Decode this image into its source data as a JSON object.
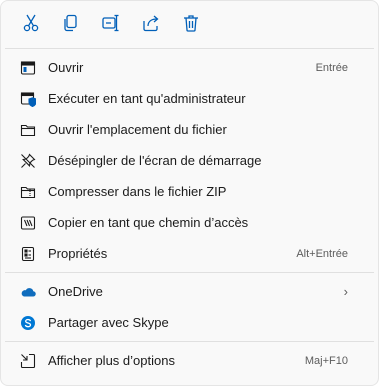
{
  "toolbar": {
    "buttons": [
      {
        "icon": "scissors-icon",
        "tooltip": "Couper"
      },
      {
        "icon": "copy-icon",
        "tooltip": "Copier"
      },
      {
        "icon": "rename-icon",
        "tooltip": "Renommer"
      },
      {
        "icon": "share-icon",
        "tooltip": "Partager"
      },
      {
        "icon": "trash-icon",
        "tooltip": "Supprimer"
      }
    ]
  },
  "group1": [
    {
      "label": "Ouvrir",
      "shortcut": "Entrée",
      "icon": "window-icon"
    },
    {
      "label": "Exécuter en tant qu'administrateur",
      "shortcut": "",
      "icon": "shield-window-icon"
    },
    {
      "label": "Ouvrir l'emplacement du fichier",
      "shortcut": "",
      "icon": "folder-icon"
    },
    {
      "label": "Désépingler de l'écran de démarrage",
      "shortcut": "",
      "icon": "unpin-icon"
    },
    {
      "label": "Compresser dans le fichier ZIP",
      "shortcut": "",
      "icon": "zip-folder-icon"
    },
    {
      "label": "Copier en tant que chemin d’accès",
      "shortcut": "",
      "icon": "copy-path-icon"
    },
    {
      "label": "Propriétés",
      "shortcut": "Alt+Entrée",
      "icon": "properties-icon"
    }
  ],
  "group2": [
    {
      "label": "OneDrive",
      "icon": "onedrive-icon",
      "submenu": "›"
    },
    {
      "label": "Partager avec Skype",
      "icon": "skype-icon"
    }
  ],
  "group3": [
    {
      "label": "Afficher plus d’options",
      "shortcut": "Maj+F10",
      "icon": "more-options-icon"
    }
  ],
  "colors": {
    "accent": "#005fb8",
    "text": "#1b1b1b",
    "muted": "#5c5c5c",
    "separator": "#e0e0e0",
    "background": "#f9f9f9",
    "onedrive": "#0f6cbd",
    "skype": "#0078d4"
  }
}
